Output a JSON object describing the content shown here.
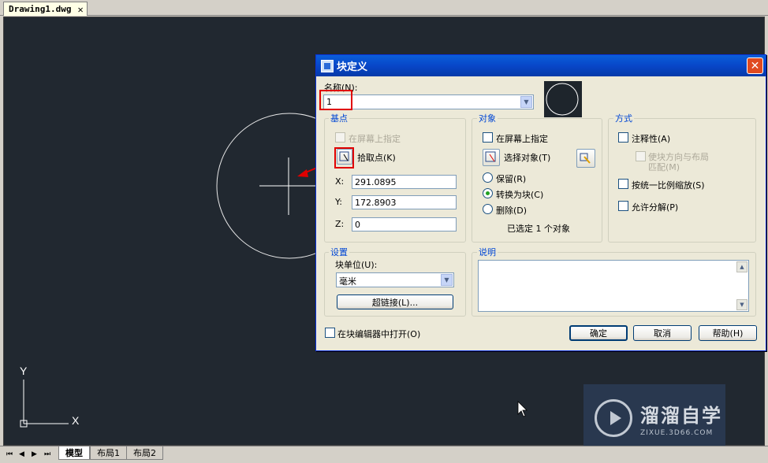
{
  "document_tab": {
    "title": "Drawing1.dwg",
    "close": "✕"
  },
  "canvas": {
    "background": "#212830",
    "ucs": {
      "x_label": "X",
      "y_label": "Y"
    }
  },
  "bottom_tabs": {
    "nav_arrows": [
      "⏮",
      "◀",
      "▶",
      "⏭"
    ],
    "tabs": [
      "模型",
      "布局1",
      "布局2"
    ],
    "active": "模型"
  },
  "dialog": {
    "title": "块定义",
    "close": "✕",
    "name": {
      "label": "名称(N):",
      "value": "1"
    },
    "base_point": {
      "title": "基点",
      "on_screen": "在屏幕上指定",
      "pick_point": "拾取点(K)",
      "x_label": "X:",
      "x_value": "291.0895",
      "y_label": "Y:",
      "y_value": "172.8903",
      "z_label": "Z:",
      "z_value": "0"
    },
    "objects": {
      "title": "对象",
      "on_screen": "在屏幕上指定",
      "select_objects": "选择对象(T)",
      "retain": "保留(R)",
      "convert": "转换为块(C)",
      "delete": "删除(D)",
      "selected_count": "已选定 1 个对象"
    },
    "behavior": {
      "title": "方式",
      "annotative": "注释性(A)",
      "match_orientation_line1": "使块方向与布局",
      "match_orientation_line2": "匹配(M)",
      "scale_uniformly": "按统一比例缩放(S)",
      "allow_explode": "允许分解(P)"
    },
    "settings": {
      "title": "设置",
      "block_unit_label": "块单位(U):",
      "block_unit_value": "毫米",
      "hyperlink": "超链接(L)..."
    },
    "description": {
      "title": "说明",
      "value": ""
    },
    "open_in_editor": "在块编辑器中打开(O)",
    "buttons": {
      "ok": "确定",
      "cancel": "取消",
      "help": "帮助(H)"
    }
  },
  "watermark": {
    "brand": "溜溜自学",
    "url": "ZIXUE.3D66.COM"
  }
}
